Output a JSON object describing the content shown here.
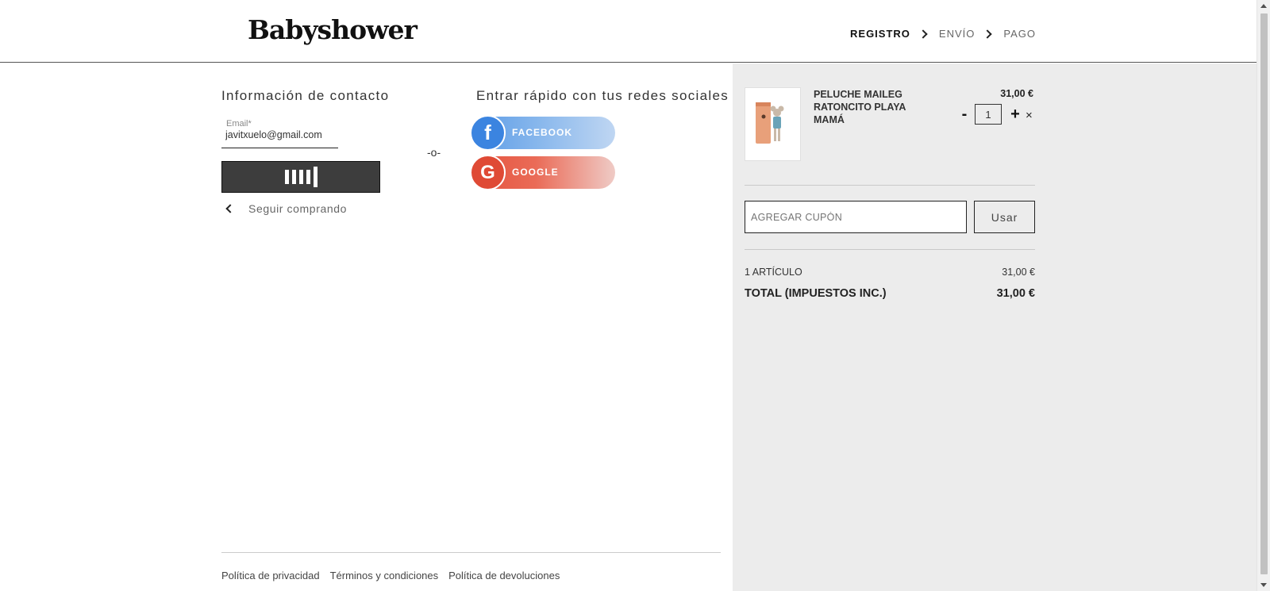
{
  "header": {
    "logo": "Babyshower",
    "steps": [
      "REGISTRO",
      "ENVÍO",
      "PAGO"
    ]
  },
  "contact": {
    "title": "Información de contacto",
    "email_label": "Email*",
    "email_value": "javitxuelo@gmail.com",
    "continue_label": "Seguir comprando",
    "separator": "-o-"
  },
  "social": {
    "title": "Entrar rápido con tus redes sociales",
    "facebook_label": "FACEBOOK",
    "google_label": "GOOGLE",
    "facebook_glyph": "f",
    "google_glyph": "G"
  },
  "footer": {
    "links": [
      "Política de privacidad",
      "Términos y condiciones",
      "Política de devoluciones"
    ]
  },
  "cart": {
    "item": {
      "name": "PELUCHE MAILEG RATONCITO PLAYA MAMÁ",
      "price": "31,00 €",
      "quantity": "1",
      "minus": "-",
      "plus": "+",
      "remove": "×"
    },
    "coupon_placeholder": "AGREGAR CUPÓN",
    "use_label": "Usar",
    "items_label": "1 ARTÍCULO",
    "items_value": "31,00 €",
    "total_label": "TOTAL (IMPUESTOS INC.)",
    "total_value": "31,00 €"
  },
  "colors": {
    "facebook": "#3b84e0",
    "google": "#df4a35",
    "sidebar_bg": "#ececec",
    "button_dark": "#3d3d3d"
  }
}
